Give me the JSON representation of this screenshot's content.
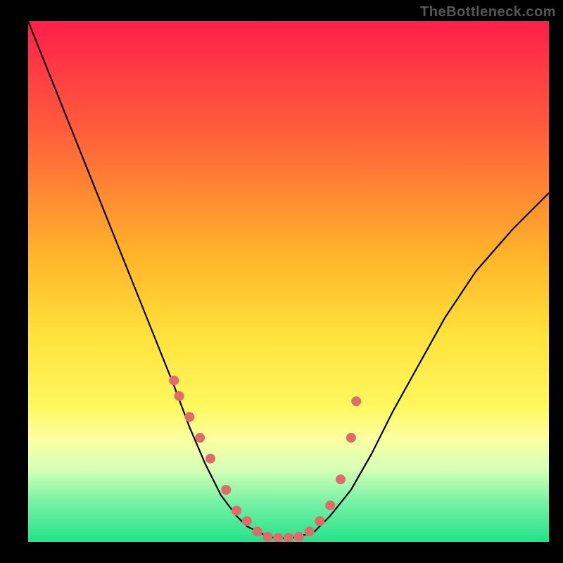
{
  "watermark": "TheBottleneck.com",
  "chart_data": {
    "type": "line",
    "title": "",
    "xlabel": "",
    "ylabel": "",
    "xlim": [
      0,
      100
    ],
    "ylim": [
      0,
      100
    ],
    "gradient_stops": [
      {
        "offset": 0,
        "color": "#ff1f4b"
      },
      {
        "offset": 20,
        "color": "#ff5a3c"
      },
      {
        "offset": 45,
        "color": "#ffb429"
      },
      {
        "offset": 60,
        "color": "#ffe13b"
      },
      {
        "offset": 74,
        "color": "#fff85e"
      },
      {
        "offset": 80,
        "color": "#fbff9e"
      },
      {
        "offset": 86,
        "color": "#d7ffb7"
      },
      {
        "offset": 92,
        "color": "#7cf3a6"
      },
      {
        "offset": 100,
        "color": "#23e28a"
      }
    ],
    "series": [
      {
        "name": "curve",
        "stroke": "#000000",
        "x": [
          0,
          4,
          8,
          12,
          16,
          20,
          24,
          28,
          31,
          34,
          37,
          40,
          42,
          44,
          46,
          48,
          50,
          52,
          55,
          58,
          62,
          66,
          70,
          75,
          80,
          86,
          93,
          100
        ],
        "y": [
          100,
          90,
          80,
          70,
          60,
          50,
          40,
          30,
          22,
          15,
          9,
          5,
          3,
          2,
          1,
          0.7,
          0.7,
          1,
          2,
          5,
          10,
          17,
          25,
          34,
          43,
          52,
          60,
          67
        ]
      }
    ],
    "markers": {
      "name": "dots",
      "color": "#e06b6b",
      "radius": 7,
      "x": [
        28,
        29,
        31,
        33,
        35,
        38,
        40,
        42,
        44,
        46,
        48,
        50,
        52,
        54,
        56,
        58,
        60,
        62,
        63
      ],
      "y": [
        31,
        28,
        24,
        20,
        16,
        10,
        6,
        4,
        2,
        1,
        0.8,
        0.8,
        1,
        2,
        4,
        7,
        12,
        20,
        27
      ]
    }
  }
}
